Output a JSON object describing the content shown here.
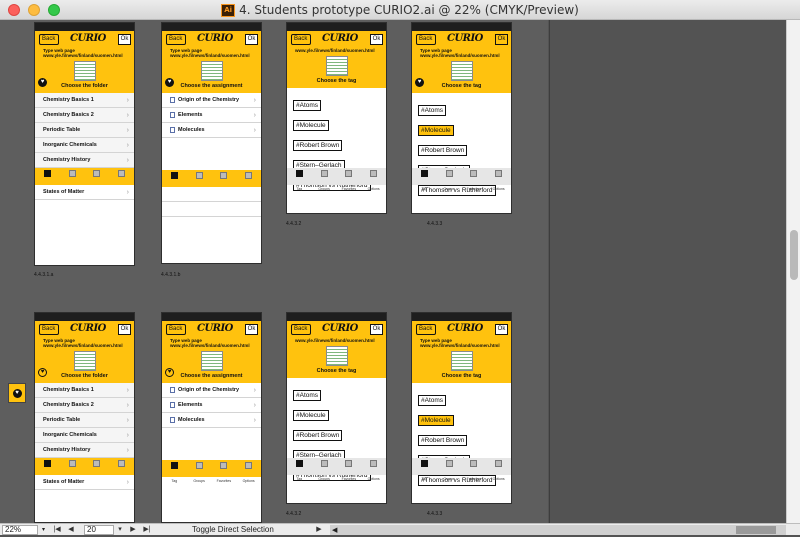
{
  "window": {
    "title": "4. Students prototype CURIO2.ai @ 22% (CMYK/Preview)",
    "app_icon": "Ai"
  },
  "phone": {
    "back": "Back",
    "logo": "CURIO",
    "ok": "Ok",
    "web_label": "Type web page",
    "web_url": "www.yle.fi/news/finland/suomen.html",
    "heart": "♥",
    "choose_folder": "Choose the folder",
    "choose_assignment": "Choose the assignment",
    "choose_tag": "Choose the tag",
    "tabs": [
      "Tag",
      "Groups",
      "Favorites",
      "Options"
    ]
  },
  "folders": [
    "Chemistry Basics 1",
    "Chemistry Basics 2",
    "Periodic Table",
    "Inorganic Chemicals",
    "Chemistry History",
    "Names of Molecules",
    "States of Matter"
  ],
  "assignments": [
    "Origin of the Chemistry",
    "Elements",
    "Molecules"
  ],
  "tags": [
    "#Atoms",
    "#Molecule",
    "#Robert Brown",
    "#Stern–Gerlach",
    "#Thomson vs Rutherford"
  ],
  "labels": {
    "a": "4.4.3.1.a",
    "b": "4.4.3.1.b",
    "c2": "4.4.3.2",
    "c3": "4.4.3.3"
  },
  "statusbar": {
    "zoom": "22%",
    "page": "20",
    "tool_status": "Toggle Direct Selection",
    "first": "|◀",
    "prev": "◀",
    "next": "▶",
    "last": "▶|",
    "dropdown": "▾"
  }
}
